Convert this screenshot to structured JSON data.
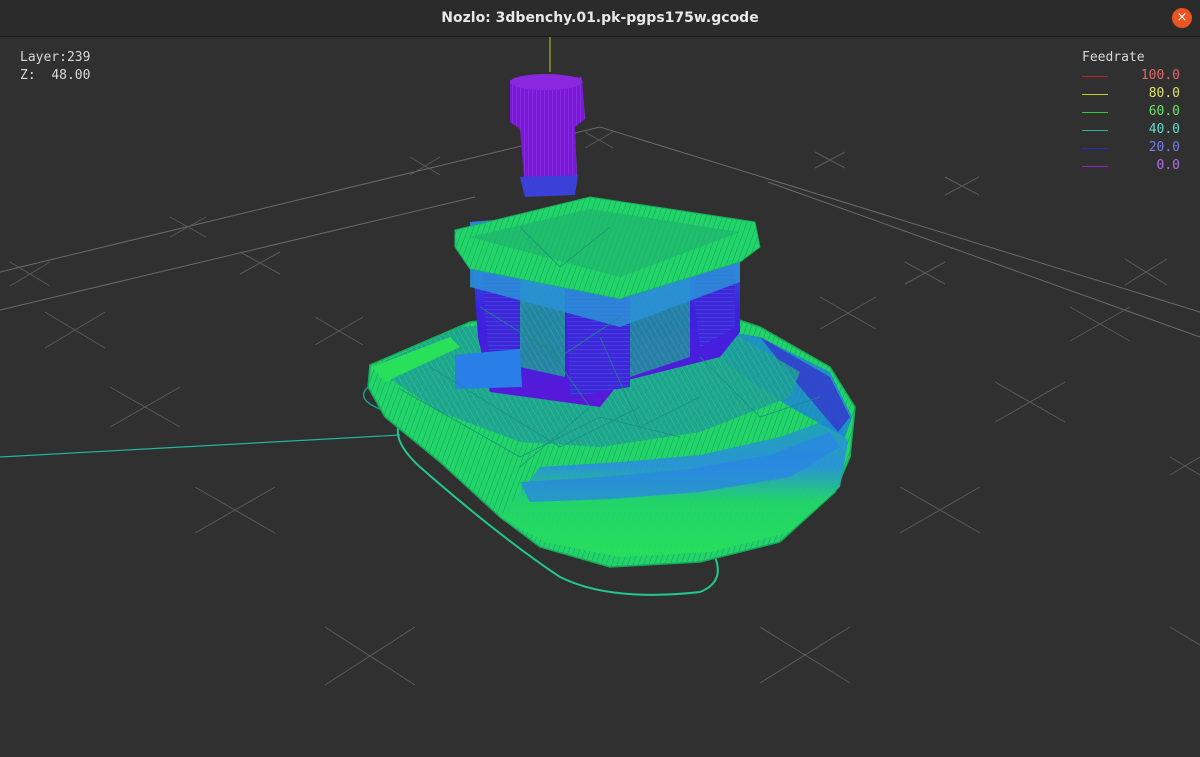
{
  "window": {
    "title": "Nozlo: 3dbenchy.01.pk-pgps175w.gcode",
    "close_glyph": "×"
  },
  "hud": {
    "layer_label": "Layer:",
    "layer_value": "239",
    "z_label": "Z:",
    "z_value": "48.00"
  },
  "legend": {
    "title": "Feedrate",
    "items": [
      {
        "value": "100.0",
        "line_color": "#b22828",
        "text_color": "#e06a6a"
      },
      {
        "value": "80.0",
        "line_color": "#c8c832",
        "text_color": "#e0e070"
      },
      {
        "value": "60.0",
        "line_color": "#32c832",
        "text_color": "#6ee06e"
      },
      {
        "value": "40.0",
        "line_color": "#28b4a0",
        "text_color": "#6ad8c8"
      },
      {
        "value": "20.0",
        "line_color": "#2828c8",
        "text_color": "#7a7ae8"
      },
      {
        "value": "0.0",
        "line_color": "#8c28c8",
        "text_color": "#b070e0"
      }
    ]
  },
  "colors": {
    "titlebar": "#2b2b2b",
    "viewport": "#303030",
    "grid_line": "#6a6a6a",
    "grid_marker": "#5a5a5a",
    "close_button": "#e95420"
  },
  "icons": {
    "close": "close-icon"
  }
}
